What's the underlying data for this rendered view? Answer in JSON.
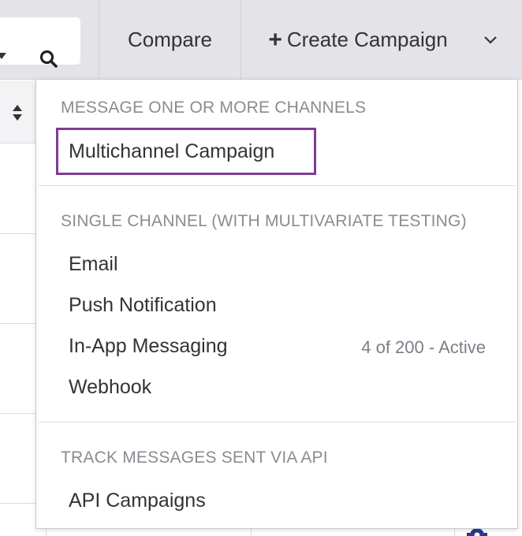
{
  "toolbar": {
    "compare_label": "Compare",
    "create_campaign_label": "Create Campaign",
    "plus_icon": "+"
  },
  "dropdown": {
    "sections": [
      {
        "title": "MESSAGE ONE OR MORE CHANNELS",
        "items": [
          {
            "label": "Multichannel Campaign",
            "selected": true
          }
        ]
      },
      {
        "title": "SINGLE CHANNEL (WITH MULTIVARIATE TESTING)",
        "items": [
          {
            "label": "Email"
          },
          {
            "label": "Push Notification"
          },
          {
            "label": "In-App Messaging",
            "meta": "4 of 200 - Active"
          },
          {
            "label": "Webhook"
          }
        ]
      },
      {
        "title": "TRACK MESSAGES SENT VIA API",
        "items": [
          {
            "label": "API Campaigns"
          }
        ]
      }
    ]
  },
  "colors": {
    "toolbar_bg": "#e3e3e8",
    "selected_border": "#7d3c98",
    "section_title": "#8b8b92",
    "meta_text": "#7a7f87",
    "gear_icon": "#2b3a8c"
  }
}
